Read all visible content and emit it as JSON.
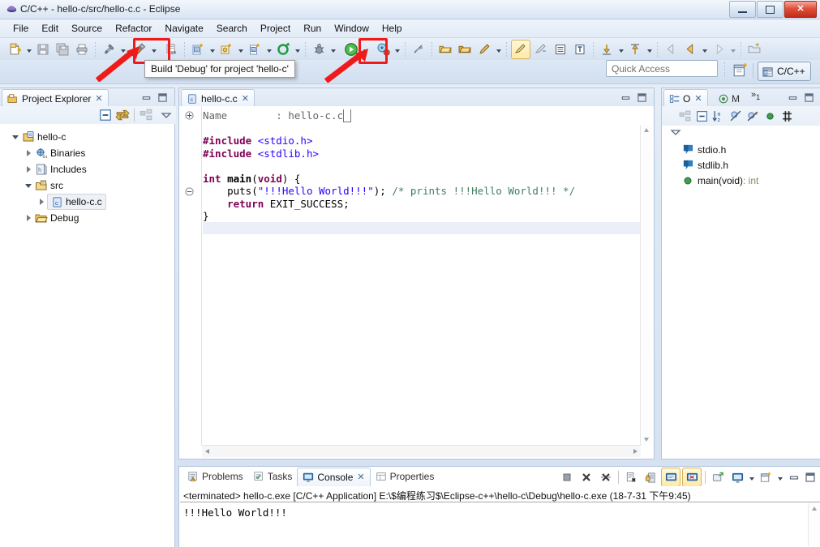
{
  "window": {
    "title": "C/C++ - hello-c/src/hello-c.c - Eclipse",
    "app_icon": "eclipse-icon",
    "minimize_label": "Minimize",
    "maximize_label": "Maximize",
    "close_label": "Close"
  },
  "menu": {
    "items": [
      {
        "label": "File"
      },
      {
        "label": "Edit"
      },
      {
        "label": "Source"
      },
      {
        "label": "Refactor"
      },
      {
        "label": "Navigate"
      },
      {
        "label": "Search"
      },
      {
        "label": "Project"
      },
      {
        "label": "Run"
      },
      {
        "label": "Window"
      },
      {
        "label": "Help"
      }
    ]
  },
  "toolbar": {
    "tooltip": "Build 'Debug' for project 'hello-c'",
    "quick_access": {
      "placeholder": "Quick Access",
      "value": ""
    },
    "perspective": {
      "label": "C/C++",
      "icon": "cpp-perspective-icon"
    },
    "open_perspective_icon": "open-perspective-icon",
    "highlight_color": "#ef1b1b",
    "buttons": [
      {
        "name": "new-wizard",
        "icon": "new-file-icon",
        "dropdown": true
      },
      {
        "name": "save",
        "icon": "save-icon",
        "dropdown": false
      },
      {
        "name": "save-all",
        "icon": "save-all-icon",
        "dropdown": false
      },
      {
        "name": "print",
        "icon": "print-icon",
        "dropdown": false
      },
      {
        "name": "build-all",
        "icon": "build-all-icon",
        "dropdown": true
      },
      {
        "name": "build-debug",
        "icon": "hammer-icon",
        "dropdown": true,
        "highlighted": true
      },
      {
        "name": "binary-toggle",
        "icon": "binary-icon",
        "dropdown": false
      },
      {
        "name": "new-c-project",
        "icon": "new-c-project-icon",
        "dropdown": true
      },
      {
        "name": "new-cpp-class",
        "icon": "new-cpp-class-icon",
        "dropdown": true
      },
      {
        "name": "new-c-file",
        "icon": "new-c-file-icon",
        "dropdown": true
      },
      {
        "name": "build-configurations",
        "icon": "build-config-icon",
        "dropdown": true
      },
      {
        "name": "debug",
        "icon": "debug-bug-icon",
        "dropdown": true
      },
      {
        "name": "run",
        "icon": "run-green-icon",
        "dropdown": true,
        "highlighted": true
      },
      {
        "name": "external-tools",
        "icon": "external-tools-icon",
        "dropdown": true
      },
      {
        "name": "skip-breakpoints",
        "icon": "skip-breakpoints-icon",
        "dropdown": false
      },
      {
        "name": "open-type",
        "icon": "open-type-icon",
        "dropdown": false
      },
      {
        "name": "open-element",
        "icon": "open-element-icon",
        "dropdown": false
      },
      {
        "name": "search",
        "icon": "search-pencil-icon",
        "dropdown": true
      },
      {
        "name": "toggle-comment",
        "icon": "comment-icon",
        "dropdown": false,
        "pressed": true
      },
      {
        "name": "toggle-block",
        "icon": "block-icon",
        "dropdown": false
      },
      {
        "name": "show-whitespace",
        "icon": "whitespace-icon",
        "dropdown": false
      },
      {
        "name": "toggle-mark",
        "icon": "mark-icon",
        "dropdown": false
      },
      {
        "name": "next-annotation",
        "icon": "next-annotation-icon",
        "dropdown": true
      },
      {
        "name": "previous-annotation",
        "icon": "prev-annotation-icon",
        "dropdown": true
      },
      {
        "name": "back",
        "icon": "back-arrow-icon",
        "dropdown": false
      },
      {
        "name": "back-history",
        "icon": "back-yellow-arrow-icon",
        "dropdown": true
      },
      {
        "name": "forward",
        "icon": "forward-arrow-icon",
        "dropdown": true
      },
      {
        "name": "new-folder",
        "icon": "new-folder-icon",
        "dropdown": false
      }
    ]
  },
  "project_explorer": {
    "tab_label": "Project Explorer",
    "tab_icon": "project-explorer-icon",
    "toolbar": [
      {
        "name": "collapse-all",
        "icon": "collapse-all-icon"
      },
      {
        "name": "link-with-editor",
        "icon": "link-editor-icon"
      },
      {
        "name": "focus-on-active-task",
        "icon": "focus-task-icon"
      },
      {
        "name": "view-menu",
        "icon": "view-menu-icon"
      }
    ],
    "tree": [
      {
        "label": "hello-c",
        "indent": 0,
        "icon": "c-project-icon",
        "expanded": true,
        "has_children": true,
        "selected": false
      },
      {
        "label": "Binaries",
        "indent": 1,
        "icon": "binaries-icon",
        "expanded": false,
        "has_children": true,
        "selected": false
      },
      {
        "label": "Includes",
        "indent": 1,
        "icon": "includes-icon",
        "expanded": false,
        "has_children": true,
        "selected": false
      },
      {
        "label": "src",
        "indent": 1,
        "icon": "source-folder-icon",
        "expanded": true,
        "has_children": true,
        "selected": false
      },
      {
        "label": "hello-c.c",
        "indent": 2,
        "icon": "c-file-icon",
        "expanded": false,
        "has_children": true,
        "selected": true
      },
      {
        "label": "Debug",
        "indent": 1,
        "icon": "folder-icon",
        "expanded": false,
        "has_children": true,
        "selected": false
      }
    ]
  },
  "editor": {
    "tab_label": "hello-c.c",
    "tab_icon": "c-file-icon",
    "close_glyph": "╳",
    "minimize_label": "Minimize",
    "maximize_label": "Maximize",
    "folded_header": {
      "marker": "⊕",
      "name_label": "Name",
      "separator": ":",
      "value": "hello-c.c"
    },
    "code_lines": [
      {
        "kind": "blank",
        "text": ""
      },
      {
        "kind": "preproc",
        "text": "#include <stdio.h>"
      },
      {
        "kind": "preproc",
        "text": "#include <stdlib.h>"
      },
      {
        "kind": "blank",
        "text": ""
      },
      {
        "kind": "func",
        "text": "int main(void) {"
      },
      {
        "kind": "call",
        "text": "    puts(\"!!!Hello World!!!\"); /* prints !!!Hello World!!! */"
      },
      {
        "kind": "return",
        "text": "    return EXIT_SUCCESS;"
      },
      {
        "kind": "close",
        "text": "}"
      }
    ]
  },
  "outline": {
    "tabs": [
      {
        "label": "O",
        "icon": "outline-icon",
        "active": true
      },
      {
        "label": "M",
        "icon": "make-target-icon",
        "active": false
      }
    ],
    "overflow_label": "1",
    "toolbar": [
      {
        "name": "focus-on-active-task",
        "icon": "focus-task-icon"
      },
      {
        "name": "collapse-all",
        "icon": "collapse-all-icon"
      },
      {
        "name": "sort",
        "icon": "sort-az-icon"
      },
      {
        "name": "hide-fields",
        "icon": "hide-fields-icon"
      },
      {
        "name": "hide-static",
        "icon": "hide-static-icon"
      },
      {
        "name": "hide-non-public",
        "icon": "hide-non-public-icon"
      },
      {
        "name": "hide-macros",
        "icon": "hide-macros-icon"
      },
      {
        "name": "view-menu",
        "icon": "view-menu-icon"
      }
    ],
    "items": [
      {
        "label": "stdio.h",
        "icon": "include-icon",
        "return_type": ""
      },
      {
        "label": "stdlib.h",
        "icon": "include-icon",
        "return_type": ""
      },
      {
        "label": "main(void)",
        "icon": "function-icon",
        "return_type": " : int"
      }
    ]
  },
  "console": {
    "tabs": [
      {
        "label": "Problems",
        "icon": "problems-icon",
        "active": false
      },
      {
        "label": "Tasks",
        "icon": "tasks-icon",
        "active": false
      },
      {
        "label": "Console",
        "icon": "console-icon",
        "active": true
      },
      {
        "label": "Properties",
        "icon": "properties-icon",
        "active": false
      }
    ],
    "close_glyph": "╳",
    "toolbar": [
      {
        "name": "terminate",
        "icon": "terminate-icon"
      },
      {
        "name": "remove-launch",
        "icon": "remove-launch-icon"
      },
      {
        "name": "remove-all-terminated",
        "icon": "remove-all-icon"
      },
      {
        "name": "clear-console",
        "icon": "clear-console-icon"
      },
      {
        "name": "scroll-lock",
        "icon": "scroll-lock-icon"
      },
      {
        "name": "pin-console",
        "icon": "pin-console-icon",
        "pressed": true
      },
      {
        "name": "display-selected-console",
        "icon": "display-console-icon",
        "pressed": true
      },
      {
        "name": "open-console",
        "icon": "open-console-icon"
      },
      {
        "name": "show-console-view",
        "icon": "show-console-icon"
      },
      {
        "name": "new-console-view",
        "icon": "new-console-icon"
      },
      {
        "name": "minimize",
        "icon": "minimize-icon"
      },
      {
        "name": "maximize",
        "icon": "maximize-icon"
      }
    ],
    "launch_line": "<terminated> hello-c.exe [C/C++ Application] E:\\$编程练习$\\Eclipse-c++\\hello-c\\Debug\\hello-c.exe (18-7-31 下午9:45)",
    "output": "!!!Hello World!!!"
  }
}
